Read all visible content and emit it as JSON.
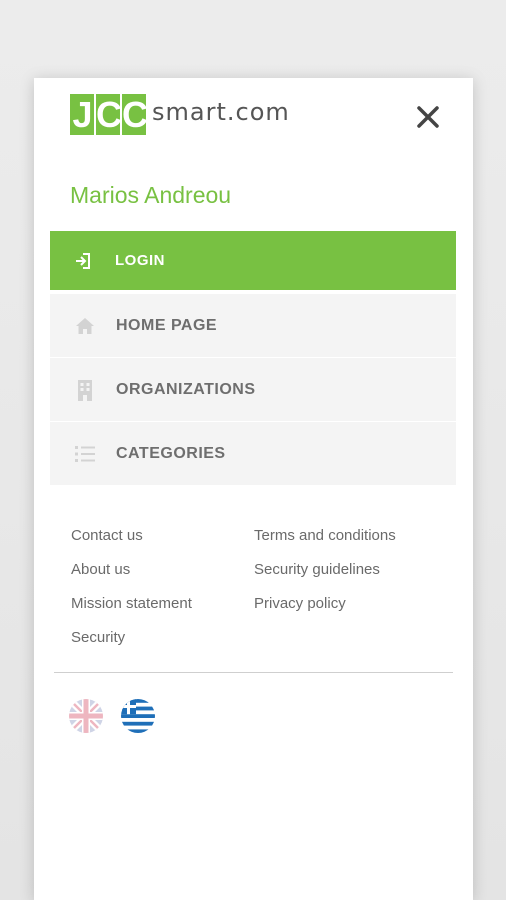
{
  "logo": {
    "letters": [
      "J",
      "C",
      "C"
    ],
    "suffix": "smart.com"
  },
  "user": {
    "name": "Marios Andreou"
  },
  "login": {
    "label": "LOGIN",
    "icon": "login-icon"
  },
  "menu": {
    "items": [
      {
        "label": "HOME PAGE",
        "icon": "home-icon"
      },
      {
        "label": "ORGANIZATIONS",
        "icon": "building-icon"
      },
      {
        "label": "CATEGORIES",
        "icon": "list-icon"
      }
    ]
  },
  "footer_links": {
    "left": [
      "Contact us",
      "About us",
      "Mission statement",
      "Security"
    ],
    "right": [
      "Terms and conditions",
      "Security guidelines",
      "Privacy policy"
    ]
  },
  "languages": [
    {
      "icon": "uk-flag-icon"
    },
    {
      "icon": "greece-flag-icon"
    }
  ],
  "colors": {
    "accent": "#78c142",
    "menu_bg": "#f4f4f4",
    "menu_text": "#6e6e6e",
    "link_text": "#6a6a6a"
  }
}
